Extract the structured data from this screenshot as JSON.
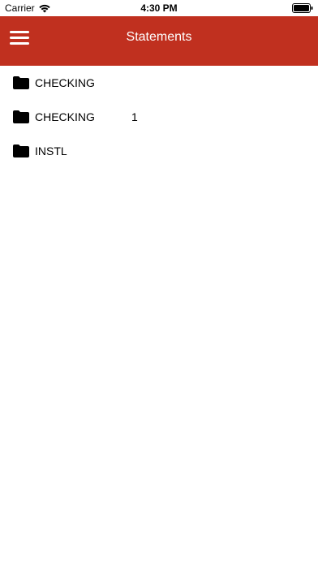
{
  "status_bar": {
    "carrier": "Carrier",
    "time": "4:30 PM"
  },
  "nav": {
    "title": "Statements",
    "color": "#c0301f"
  },
  "folders": [
    {
      "label": "CHECKING",
      "count": ""
    },
    {
      "label": "CHECKING",
      "count": "1"
    },
    {
      "label": "INSTL",
      "count": ""
    }
  ]
}
